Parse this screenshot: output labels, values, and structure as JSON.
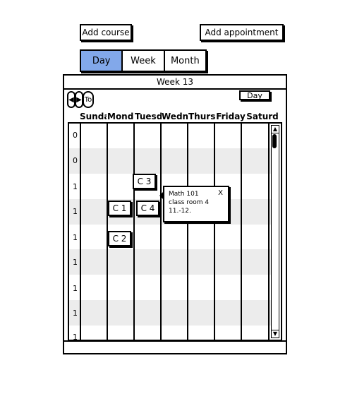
{
  "toolbar": {
    "add_course": "Add course",
    "add_appointment": "Add appointment"
  },
  "view_tabs": [
    {
      "label": "Day",
      "selected": true
    },
    {
      "label": "Week",
      "selected": false
    },
    {
      "label": "Month",
      "selected": false
    }
  ],
  "calendar": {
    "title": "Week 13",
    "nav": {
      "today_label": "To"
    },
    "view_select": "Day",
    "days": [
      "Sunda",
      "Monda",
      "Tuesd",
      "Wedn",
      "Thurs",
      "Friday",
      "Saturd"
    ],
    "hours": [
      "0",
      "0",
      "1",
      "1",
      "1",
      "1",
      "1",
      "1",
      "1"
    ],
    "courses": [
      {
        "label": "C 3"
      },
      {
        "label": "C 1"
      },
      {
        "label": "C 4"
      },
      {
        "label": "C 2"
      }
    ],
    "popup": {
      "close": "X",
      "line1": "Math 101",
      "line2": "class room 4",
      "line3": "11.-12."
    }
  },
  "colors": {
    "selected_tab": "#82a8ea",
    "stripe": "#ececec"
  }
}
